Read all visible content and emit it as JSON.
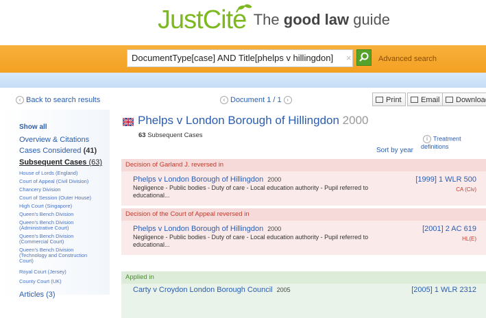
{
  "header": {
    "brand": "JustCite",
    "tagline_pre": "The ",
    "tagline_bold": "good law",
    "tagline_post": " guide"
  },
  "search": {
    "value": "DocumentType[case] AND Title[phelps v hillingdon]",
    "advanced_label": "Advanced search"
  },
  "nav": {
    "back_label": "Back to search results",
    "document_label": "Document 1 / 1",
    "print_label": "Print",
    "email_label": "Email",
    "download_label": "Download"
  },
  "sidebar": {
    "show_all": "Show all",
    "overview": "Overview & Citations",
    "considered_label": "Cases Considered",
    "considered_count": "(41)",
    "subsequent_label": "Subsequent Cases",
    "subsequent_count": "(63)",
    "courts": [
      "House of Lords (England)",
      "Court of Appeal (Civil Division)",
      "Chancery Division",
      "Court of Session (Outer House)",
      "High Court (Singapore)",
      "Queen's Bench Division",
      "Queen's Bench Division",
      "(Administrative Court)",
      "Queen's Bench Division",
      "(Commercial Court)",
      "Queen's Bench Division",
      "(Technology and Construction",
      "Court)",
      "Royal Court (Jersey)",
      "County Court (UK)"
    ],
    "articles": "Articles (3)"
  },
  "main": {
    "case_title": "Phelps v London Borough of Hillingdon",
    "case_year": "2000",
    "subsequent_count": "63",
    "subsequent_label": "Subsequent Cases",
    "treatment_label": "Treatment definitions",
    "sort_label": "Sort by year",
    "sections": [
      {
        "heading": "Decision of Garland J. reversed in",
        "title": "Phelps v London Borough of Hillingdon",
        "year": "2000",
        "citation": "[1999] 1 WLR 500",
        "court": "CA (Civ)",
        "desc": "Negligence - Public bodies - Duty of care - Local education authority - Pupil referred to educational..."
      },
      {
        "heading": "Decision of the Court of Appeal reversed in",
        "title": "Phelps v London Borough of Hillingdon",
        "year": "2000",
        "citation": "[2001] 2 AC 619",
        "court": "HL(E)",
        "desc": "Negligence - Public bodies - Duty of care - Local education authority - Pupil referred to educational..."
      },
      {
        "heading": "Applied in",
        "title": "Carty v Croydon London Borough Council",
        "year": "2005",
        "citation": "[2005] 1 WLR 2312"
      }
    ]
  },
  "colors": {
    "accent_orange": "#f3a022",
    "link_blue": "#2a5db0",
    "brand_green": "#7cb81e",
    "reversed_red": "#c23a2a"
  }
}
